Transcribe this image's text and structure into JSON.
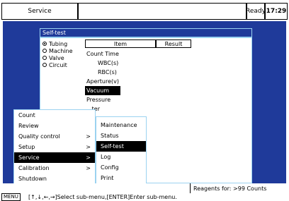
{
  "header": {
    "title": "Service",
    "status": "Ready",
    "time": "17:29"
  },
  "selftest": {
    "title": "Self-test",
    "options": [
      {
        "label": "Tubing",
        "selected": true
      },
      {
        "label": "Machine",
        "selected": false
      },
      {
        "label": "Valve",
        "selected": false
      },
      {
        "label": "Circuit",
        "selected": false
      }
    ],
    "columns": [
      "Item",
      "Result"
    ],
    "items": [
      "Count Time",
      "WBC(s)",
      "RBC(s)",
      "Aperture(v)",
      "Vacuum",
      "Pressure",
      "...ter"
    ]
  },
  "menu": {
    "main": [
      {
        "label": "Count",
        "arrow": false
      },
      {
        "label": "Review",
        "arrow": false
      },
      {
        "label": "Quality control",
        "arrow": true
      },
      {
        "label": "Setup",
        "arrow": true
      },
      {
        "label": "Service",
        "arrow": true,
        "selected": true
      },
      {
        "label": "Calibration",
        "arrow": true
      },
      {
        "label": "Shutdown",
        "arrow": false
      }
    ],
    "sub": [
      {
        "label": "Maintenance"
      },
      {
        "label": "Status"
      },
      {
        "label": "Self-test",
        "selected": true
      },
      {
        "label": "Log"
      },
      {
        "label": "Config"
      },
      {
        "label": "Print"
      }
    ]
  },
  "footer": {
    "reagents": "Reagents for: >99 Counts",
    "menu_label": "MENU",
    "help": "[↑,↓,←,→]Select sub-menu,[ENTER]Enter sub-menu."
  }
}
